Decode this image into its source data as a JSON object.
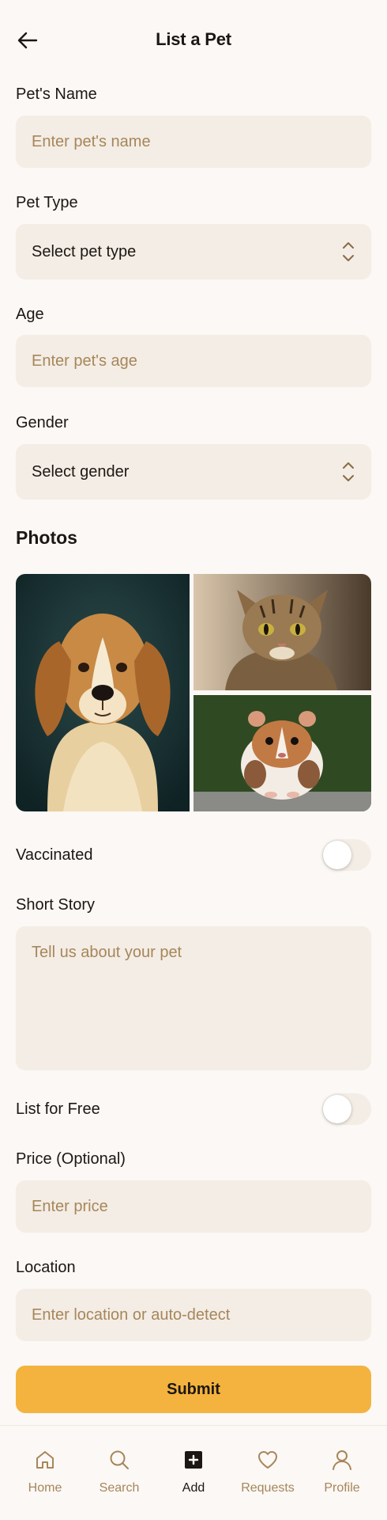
{
  "header": {
    "title": "List a Pet",
    "back_icon": "arrow-left-icon"
  },
  "form": {
    "name": {
      "label": "Pet's Name",
      "placeholder": "Enter pet's name"
    },
    "type": {
      "label": "Pet Type",
      "value": "Select pet type"
    },
    "age": {
      "label": "Age",
      "placeholder": "Enter pet's age"
    },
    "gender": {
      "label": "Gender",
      "value": "Select gender"
    },
    "photos": {
      "title": "Photos"
    },
    "vaccinated": {
      "label": "Vaccinated",
      "on": false
    },
    "story": {
      "label": "Short Story",
      "placeholder": "Tell us about your pet"
    },
    "free": {
      "label": "List for Free",
      "on": false
    },
    "price": {
      "label": "Price (Optional)",
      "placeholder": "Enter price"
    },
    "location": {
      "label": "Location",
      "placeholder": "Enter location or auto-detect"
    },
    "submit_label": "Submit"
  },
  "nav": {
    "items": [
      {
        "label": "Home",
        "icon": "home-icon"
      },
      {
        "label": "Search",
        "icon": "search-icon"
      },
      {
        "label": "Add",
        "icon": "plus-square-icon",
        "active": true
      },
      {
        "label": "Requests",
        "icon": "heart-icon"
      },
      {
        "label": "Profile",
        "icon": "user-icon"
      }
    ]
  },
  "colors": {
    "accent": "#f4b33f",
    "field_bg": "#f3ede5",
    "placeholder": "#a7865a",
    "background": "#fbf8f5"
  }
}
